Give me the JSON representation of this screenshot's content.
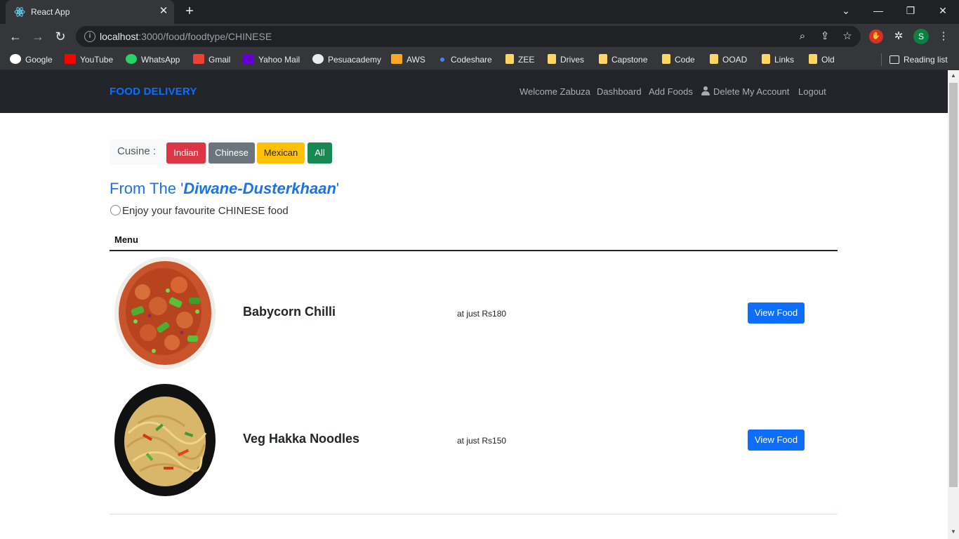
{
  "browser": {
    "tab_title": "React App",
    "url_host": "localhost",
    "url_path": ":3000/food/foodtype/CHINESE",
    "bookmarks": [
      {
        "label": "Google",
        "color": "#ffffff"
      },
      {
        "label": "YouTube",
        "color": "#ff0000"
      },
      {
        "label": "WhatsApp",
        "color": "#25d366"
      },
      {
        "label": "Gmail",
        "color": "#ea4335"
      },
      {
        "label": "Yahoo Mail",
        "color": "#6001d2"
      },
      {
        "label": "Pesuacademy",
        "color": "#e8eaed"
      },
      {
        "label": "AWS",
        "color": "#f9a825"
      },
      {
        "label": "Codeshare",
        "color": "#4285f4"
      },
      {
        "label": "ZEE",
        "color": "#fdd663"
      },
      {
        "label": "Drives",
        "color": "#fdd663"
      },
      {
        "label": "Capstone",
        "color": "#fdd663"
      },
      {
        "label": "Code",
        "color": "#fdd663"
      },
      {
        "label": "OOAD",
        "color": "#fdd663"
      },
      {
        "label": "Links",
        "color": "#fdd663"
      },
      {
        "label": "Old",
        "color": "#fdd663"
      }
    ],
    "reading_list": "Reading list",
    "avatar_letter": "S"
  },
  "navbar": {
    "brand": "FOOD DELIVERY",
    "welcome": "Welcome Zabuza",
    "dashboard": "Dashboard",
    "add_foods": "Add Foods",
    "delete_account": "Delete My Account",
    "logout": "Logout"
  },
  "cuisine": {
    "label": "Cusine :",
    "buttons": [
      {
        "label": "Indian",
        "color": "#dc3545"
      },
      {
        "label": "Chinese",
        "color": "#6c757d"
      },
      {
        "label": "Mexican",
        "color": "#ffc107"
      },
      {
        "label": "All",
        "color": "#198754"
      }
    ]
  },
  "heading": {
    "prefix": "From The '",
    "restaurant": "Diwane-Dusterkhaan",
    "suffix": "'",
    "subtitle": "Enjoy your favourite CHINESE food"
  },
  "menu": {
    "header": "Menu",
    "items": [
      {
        "name": "Babycorn Chilli",
        "price": "at just Rs180",
        "button": "View Food"
      },
      {
        "name": "Veg Hakka Noodles",
        "price": "at just Rs150",
        "button": "View Food"
      }
    ]
  },
  "colors": {
    "primary": "#0d6efd",
    "navbar_bg": "#212529"
  }
}
